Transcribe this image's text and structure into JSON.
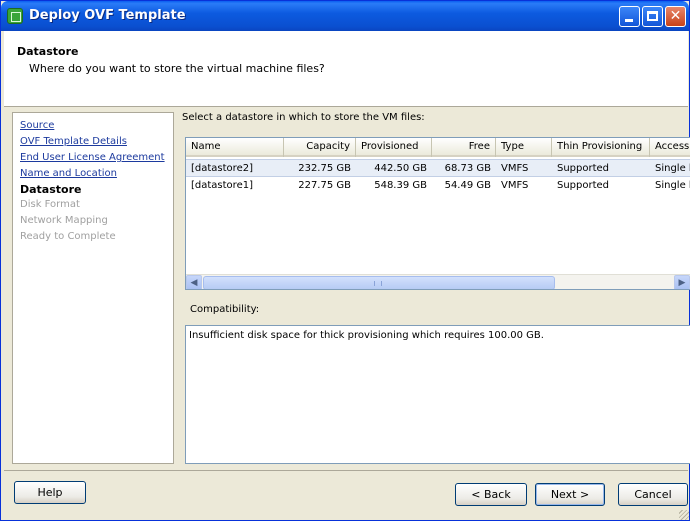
{
  "window": {
    "title": "Deploy OVF Template",
    "accent": "#0a5ef0"
  },
  "header": {
    "title": "Datastore",
    "subtitle": "Where do you want to store the virtual machine files?"
  },
  "nav": {
    "items": [
      {
        "label": "Source",
        "state": "link"
      },
      {
        "label": "OVF Template Details",
        "state": "link"
      },
      {
        "label": "End User License Agreement",
        "state": "link"
      },
      {
        "label": "Name and Location",
        "state": "link"
      },
      {
        "label": "Datastore",
        "state": "current"
      },
      {
        "label": "Disk Format",
        "state": "disabled"
      },
      {
        "label": "Network Mapping",
        "state": "disabled"
      },
      {
        "label": "Ready to Complete",
        "state": "disabled"
      }
    ]
  },
  "main": {
    "instruction": "Select a datastore in which to store the VM files:",
    "table": {
      "columns": [
        "Name",
        "Capacity",
        "Provisioned",
        "Free",
        "Type",
        "Thin Provisioning",
        "Access"
      ],
      "rows": [
        [
          "[datastore2]",
          "232.75 GB",
          "442.50 GB",
          "68.73 GB",
          "VMFS",
          "Supported",
          "Single host"
        ],
        [
          "[datastore1]",
          "227.75 GB",
          "548.39 GB",
          "54.49 GB",
          "VMFS",
          "Supported",
          "Single host"
        ]
      ],
      "selected_row": 0
    },
    "compatibility_label": "Compatibility:",
    "compatibility_text": "Insufficient disk space for thick provisioning which requires 100.00 GB."
  },
  "footer": {
    "help": "Help",
    "back": "< Back",
    "next": "Next >",
    "cancel": "Cancel"
  },
  "icons": {
    "app": "vm-deploy-icon",
    "minimize": "minimize-icon",
    "maximize": "maximize-icon",
    "close": "close-icon",
    "scroll_left": "chevron-left-icon",
    "scroll_right": "chevron-right-icon"
  }
}
